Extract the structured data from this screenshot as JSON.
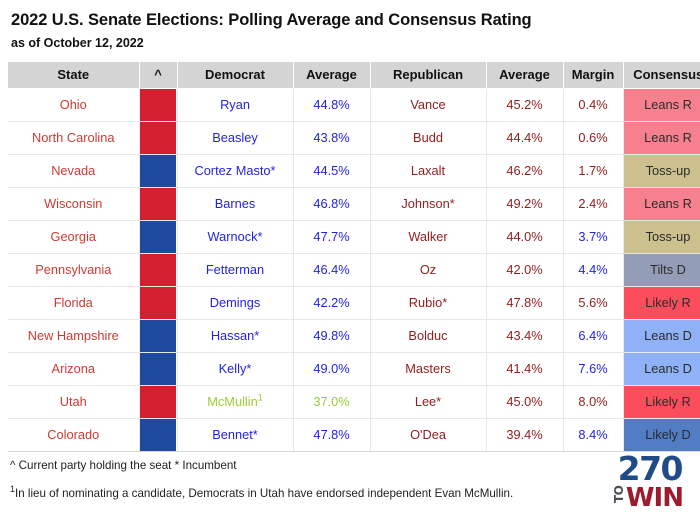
{
  "header": {
    "title": "2022 U.S. Senate Elections: Polling Average and Consensus Rating",
    "subtitle": "as of October 12, 2022"
  },
  "table": {
    "columns": [
      {
        "key": "state",
        "label": "State"
      },
      {
        "key": "party_bar",
        "label": "^"
      },
      {
        "key": "democrat",
        "label": "Democrat"
      },
      {
        "key": "dem_average",
        "label": "Average"
      },
      {
        "key": "republican",
        "label": "Republican"
      },
      {
        "key": "rep_average",
        "label": "Average"
      },
      {
        "key": "margin",
        "label": "Margin"
      },
      {
        "key": "consensus",
        "label": "Consensus"
      }
    ],
    "rows": [
      {
        "state": "Ohio",
        "party": "R",
        "democrat": "Ryan",
        "dem_average": "44.8%",
        "republican": "Vance",
        "rep_average": "45.2%",
        "margin": "0.4%",
        "margin_lead": "R",
        "consensus": "Leans R",
        "consensus_class": "cons-leansR",
        "dem_is_independent": false,
        "dem_footnote": ""
      },
      {
        "state": "North Carolina",
        "party": "R",
        "democrat": "Beasley",
        "dem_average": "43.8%",
        "republican": "Budd",
        "rep_average": "44.4%",
        "margin": "0.6%",
        "margin_lead": "R",
        "consensus": "Leans R",
        "consensus_class": "cons-leansR",
        "dem_is_independent": false,
        "dem_footnote": ""
      },
      {
        "state": "Nevada",
        "party": "D",
        "democrat": "Cortez Masto*",
        "dem_average": "44.5%",
        "republican": "Laxalt",
        "rep_average": "46.2%",
        "margin": "1.7%",
        "margin_lead": "R",
        "consensus": "Toss-up",
        "consensus_class": "cons-tossup",
        "dem_is_independent": false,
        "dem_footnote": ""
      },
      {
        "state": "Wisconsin",
        "party": "R",
        "democrat": "Barnes",
        "dem_average": "46.8%",
        "republican": "Johnson*",
        "rep_average": "49.2%",
        "margin": "2.4%",
        "margin_lead": "R",
        "consensus": "Leans R",
        "consensus_class": "cons-leansR",
        "dem_is_independent": false,
        "dem_footnote": ""
      },
      {
        "state": "Georgia",
        "party": "D",
        "democrat": "Warnock*",
        "dem_average": "47.7%",
        "republican": "Walker",
        "rep_average": "44.0%",
        "margin": "3.7%",
        "margin_lead": "D",
        "consensus": "Toss-up",
        "consensus_class": "cons-tossup",
        "dem_is_independent": false,
        "dem_footnote": ""
      },
      {
        "state": "Pennsylvania",
        "party": "R",
        "democrat": "Fetterman",
        "dem_average": "46.4%",
        "republican": "Oz",
        "rep_average": "42.0%",
        "margin": "4.4%",
        "margin_lead": "D",
        "consensus": "Tilts D",
        "consensus_class": "cons-tiltsD",
        "dem_is_independent": false,
        "dem_footnote": ""
      },
      {
        "state": "Florida",
        "party": "R",
        "democrat": "Demings",
        "dem_average": "42.2%",
        "republican": "Rubio*",
        "rep_average": "47.8%",
        "margin": "5.6%",
        "margin_lead": "R",
        "consensus": "Likely R",
        "consensus_class": "cons-likelyR",
        "dem_is_independent": false,
        "dem_footnote": ""
      },
      {
        "state": "New Hampshire",
        "party": "D",
        "democrat": "Hassan*",
        "dem_average": "49.8%",
        "republican": "Bolduc",
        "rep_average": "43.4%",
        "margin": "6.4%",
        "margin_lead": "D",
        "consensus": "Leans D",
        "consensus_class": "cons-leansD",
        "dem_is_independent": false,
        "dem_footnote": ""
      },
      {
        "state": "Arizona",
        "party": "D",
        "democrat": "Kelly*",
        "dem_average": "49.0%",
        "republican": "Masters",
        "rep_average": "41.4%",
        "margin": "7.6%",
        "margin_lead": "D",
        "consensus": "Leans D",
        "consensus_class": "cons-leansD",
        "dem_is_independent": false,
        "dem_footnote": ""
      },
      {
        "state": "Utah",
        "party": "R",
        "democrat": "McMullin",
        "dem_average": "37.0%",
        "republican": "Lee*",
        "rep_average": "45.0%",
        "margin": "8.0%",
        "margin_lead": "R",
        "consensus": "Likely R",
        "consensus_class": "cons-likelyR",
        "dem_is_independent": true,
        "dem_footnote": "1"
      },
      {
        "state": "Colorado",
        "party": "D",
        "democrat": "Bennet*",
        "dem_average": "47.8%",
        "republican": "O'Dea",
        "rep_average": "39.4%",
        "margin": "8.4%",
        "margin_lead": "D",
        "consensus": "Likely D",
        "consensus_class": "cons-likelyD",
        "dem_is_independent": false,
        "dem_footnote": ""
      }
    ]
  },
  "footnotes": {
    "line1": "^ Current party holding the seat  * Incumbent",
    "line2_marker": "1",
    "line2": "In lieu of nominating a candidate, Democrats in Utah have endorsed independent Evan McMullin."
  },
  "logo": {
    "number": "270",
    "to": "TO",
    "win": "WIN"
  },
  "colors": {
    "party_republican": "#d22030",
    "party_democrat": "#1d4a9e",
    "leans_r": "#f7808f",
    "toss_up": "#cbc08e",
    "tilts_d": "#949db8",
    "likely_r": "#fc4d5c",
    "leans_d": "#8fb1f6",
    "likely_d": "#527cc4",
    "state_text": "#cc3b33",
    "democrat_text": "#2323e0",
    "republican_text": "#8f1d1d",
    "independent_text": "#9acd32",
    "header_background": "#d4d4d4"
  }
}
